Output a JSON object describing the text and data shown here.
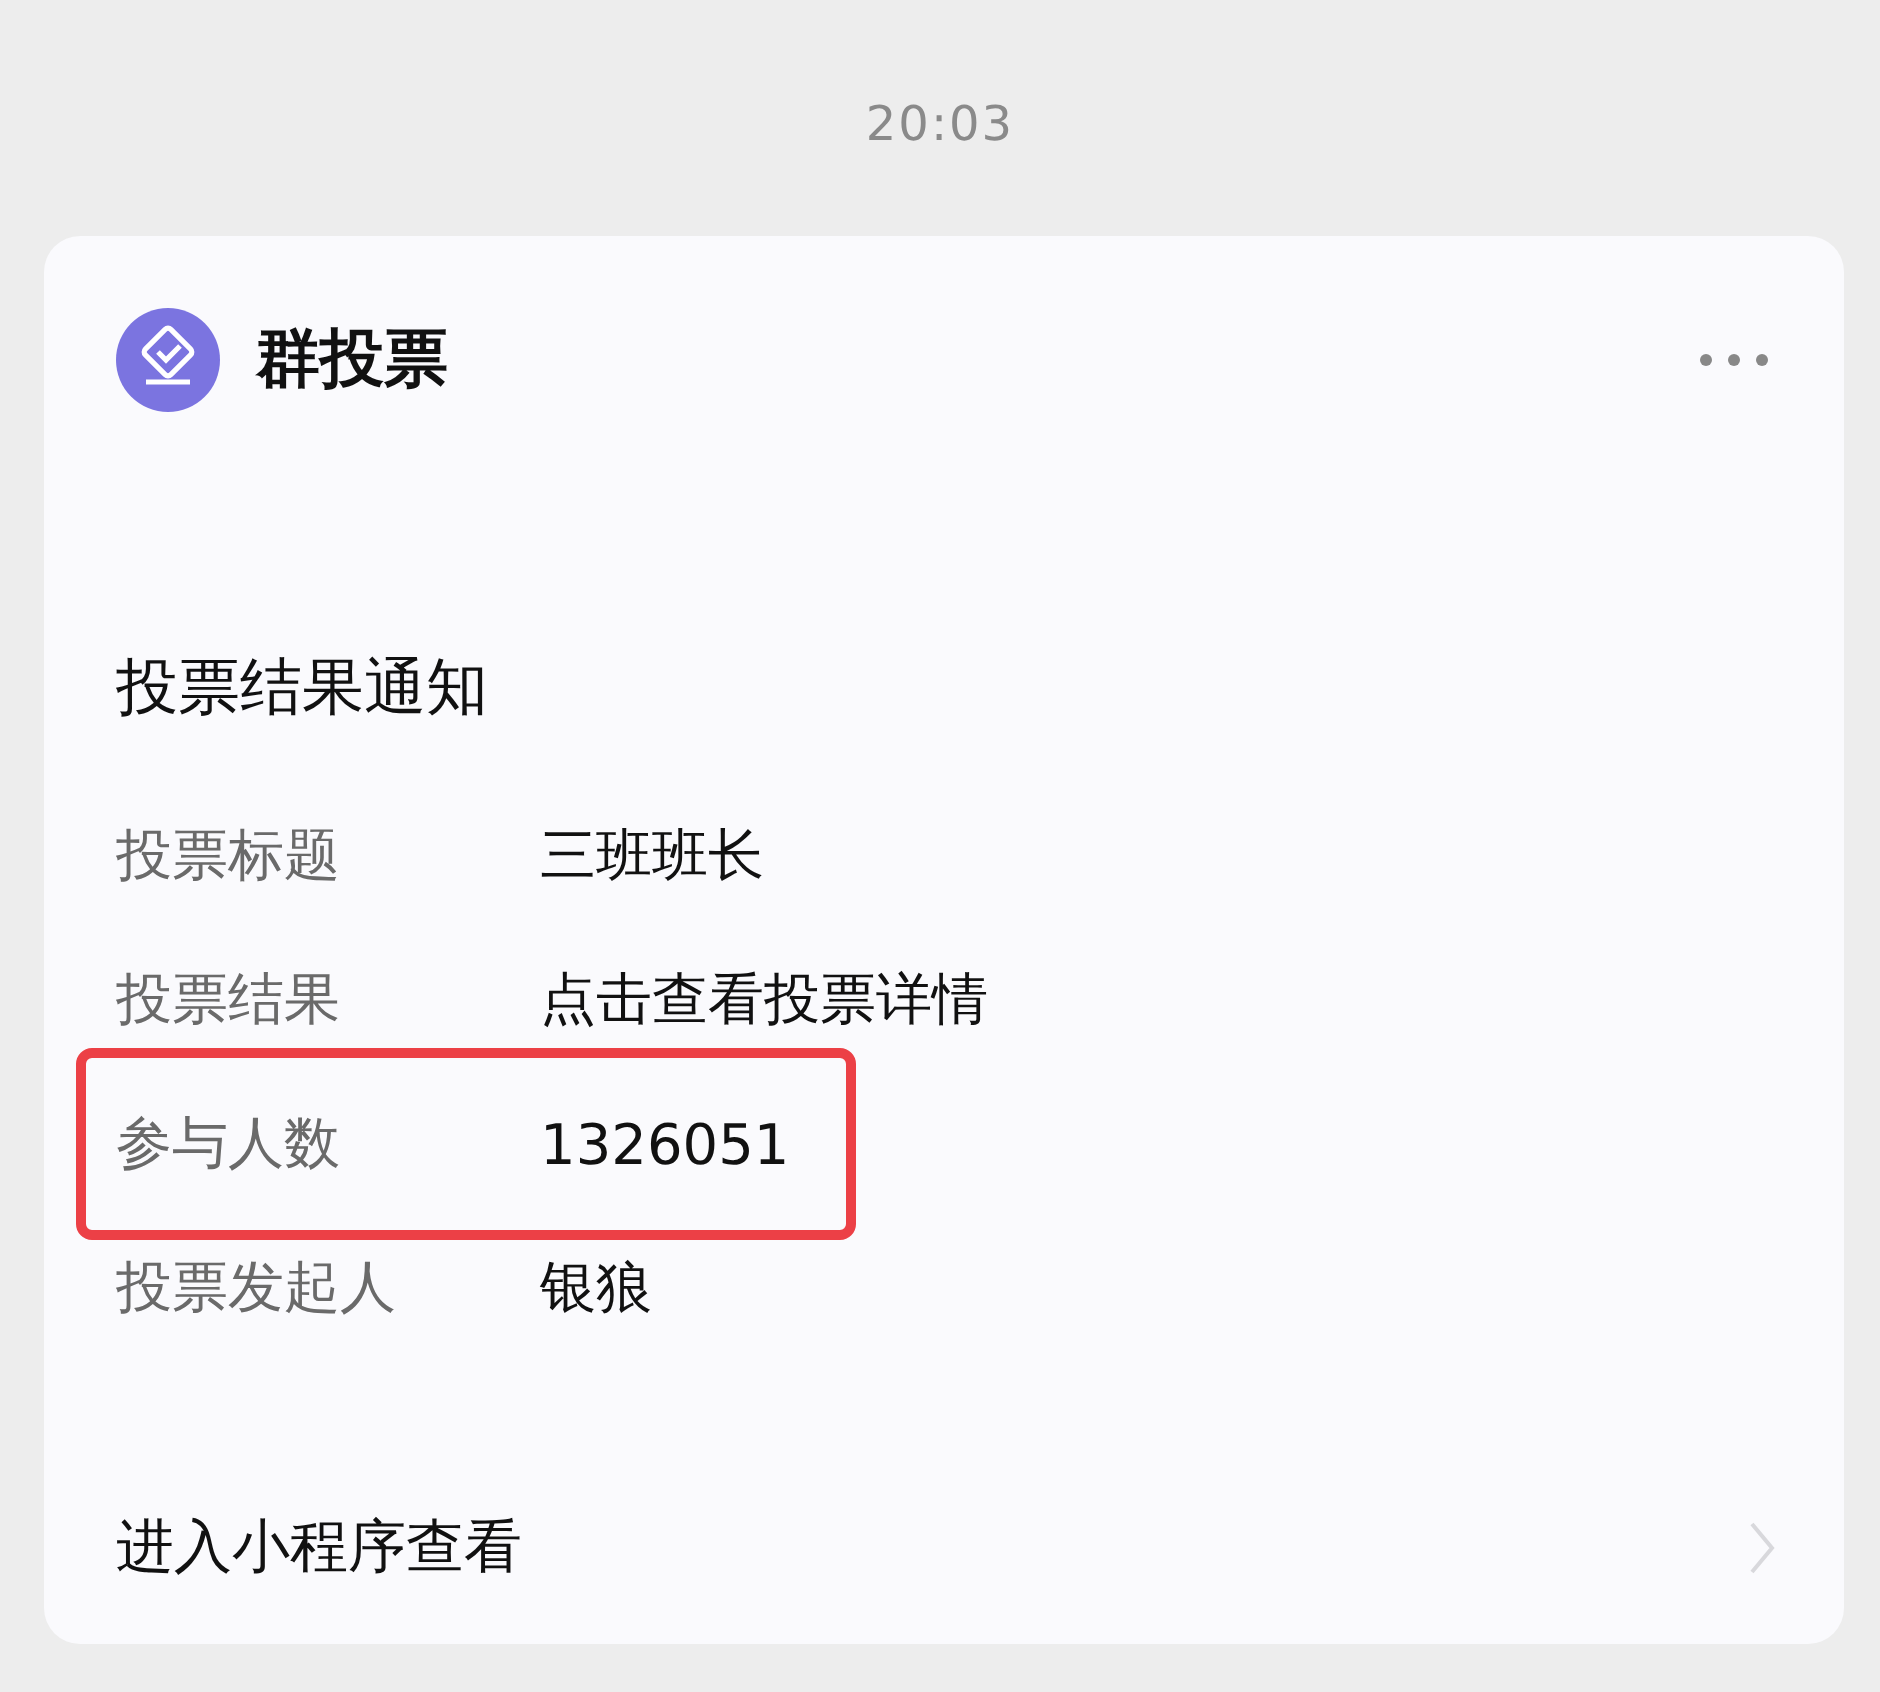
{
  "time": "20:03",
  "card": {
    "app_name": "群投票",
    "title": "投票结果通知",
    "rows": [
      {
        "label": "投票标题",
        "value": "三班班长",
        "highlighted": false
      },
      {
        "label": "投票结果",
        "value": "点击查看投票详情",
        "highlighted": false
      },
      {
        "label": "参与人数",
        "value": "1326051",
        "highlighted": true
      },
      {
        "label": "投票发起人",
        "value": "银狼",
        "highlighted": false
      }
    ],
    "footer_link": "进入小程序查看"
  }
}
